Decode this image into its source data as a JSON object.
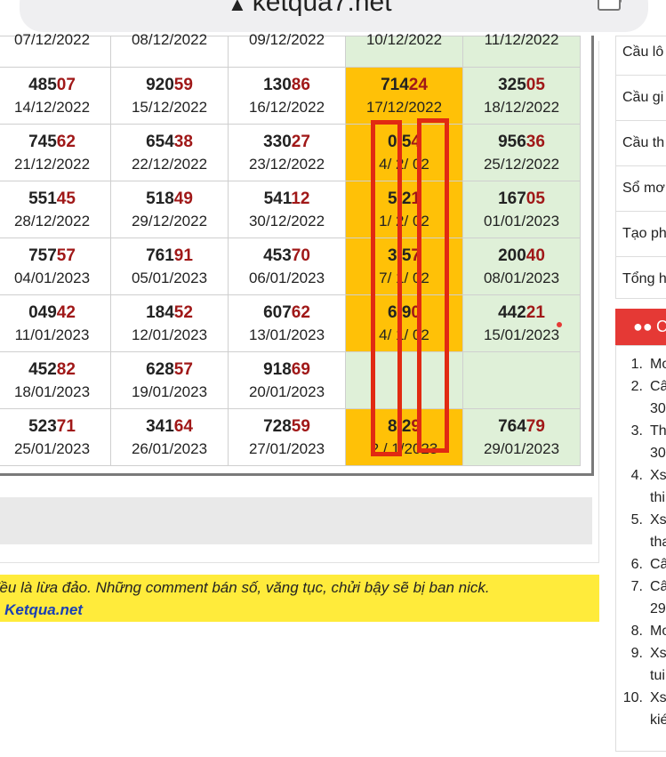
{
  "browser": {
    "url": "ketqua7.net",
    "lock_icon": "lock-icon"
  },
  "table": {
    "header_dates": [
      "07/12/2022",
      "08/12/2022",
      "09/12/2022",
      "10/12/2022",
      "11/12/2022"
    ],
    "rows": [
      [
        {
          "head": "485",
          "tail": "07",
          "date": "14/12/2022"
        },
        {
          "head": "920",
          "tail": "59",
          "date": "15/12/2022"
        },
        {
          "head": "130",
          "tail": "86",
          "date": "16/12/2022"
        },
        {
          "head": "714",
          "tail": "24",
          "date": "17/12/2022"
        },
        {
          "head": "325",
          "tail": "05",
          "date": "18/12/2022"
        }
      ],
      [
        {
          "head": "745",
          "tail": "62",
          "date": "21/12/2022"
        },
        {
          "head": "654",
          "tail": "38",
          "date": "22/12/2022"
        },
        {
          "head": "330",
          "tail": "27",
          "date": "23/12/2022"
        },
        {
          "head": "0 5",
          "tail": "4",
          "date": "4/ 2/ 02"
        },
        {
          "head": "956",
          "tail": "36",
          "date": "25/12/2022"
        }
      ],
      [
        {
          "head": "551",
          "tail": "45",
          "date": "28/12/2022"
        },
        {
          "head": "518",
          "tail": "49",
          "date": "29/12/2022"
        },
        {
          "head": "541",
          "tail": "12",
          "date": "30/12/2022"
        },
        {
          "head": "5 2",
          "tail": "1",
          "date": "1/ 2/ 02"
        },
        {
          "head": "167",
          "tail": "05",
          "date": "01/01/2023"
        }
      ],
      [
        {
          "head": "757",
          "tail": "57",
          "date": "04/01/2023"
        },
        {
          "head": "761",
          "tail": "91",
          "date": "05/01/2023"
        },
        {
          "head": "453",
          "tail": "70",
          "date": "06/01/2023"
        },
        {
          "head": "3 5",
          "tail": "7",
          "date": "7/ 1/ 02"
        },
        {
          "head": "200",
          "tail": "40",
          "date": "08/01/2023"
        }
      ],
      [
        {
          "head": "049",
          "tail": "42",
          "date": "11/01/2023"
        },
        {
          "head": "184",
          "tail": "52",
          "date": "12/01/2023"
        },
        {
          "head": "607",
          "tail": "62",
          "date": "13/01/2023"
        },
        {
          "head": "6 9",
          "tail": "0",
          "date": "4/ 1/ 02"
        },
        {
          "head": "442",
          "tail": "21",
          "date": "15/01/2023"
        }
      ],
      [
        {
          "head": "452",
          "tail": "82",
          "date": "18/01/2023"
        },
        {
          "head": "628",
          "tail": "57",
          "date": "19/01/2023"
        },
        {
          "head": "918",
          "tail": "69",
          "date": "20/01/2023"
        },
        {
          "head": "",
          "tail": "",
          "date": ""
        },
        {
          "head": "",
          "tail": "",
          "date": ""
        }
      ],
      [
        {
          "head": "523",
          "tail": "71",
          "date": "25/01/2023"
        },
        {
          "head": "341",
          "tail": "64",
          "date": "26/01/2023"
        },
        {
          "head": "728",
          "tail": "59",
          "date": "27/01/2023"
        },
        {
          "head": "8 2",
          "tail": "9",
          "date": "2 / 1/2023"
        },
        {
          "head": "764",
          "tail": "79",
          "date": "29/01/2023"
        }
      ]
    ]
  },
  "warning": {
    "line1": "đều là lừa đảo. Những comment bán số, văng tục, chửi bậy sẽ bị ban nick.",
    "line2": "n Ketqua.net"
  },
  "sidebar": {
    "links": [
      "Cầu lô",
      "Cầu gi",
      "Cầu th",
      "Sổ mơ",
      "Tạo ph",
      "Tổng h"
    ],
    "section_title": "C",
    "section_icon": "users-icon",
    "list": [
      {
        "n": "1.",
        "lines": [
          "Mo"
        ]
      },
      {
        "n": "2.",
        "lines": [
          "Câ",
          "30"
        ]
      },
      {
        "n": "3.",
        "lines": [
          "Th",
          "30"
        ]
      },
      {
        "n": "4.",
        "lines": [
          "Xs",
          "thi"
        ]
      },
      {
        "n": "5.",
        "lines": [
          "Xs",
          "tha"
        ]
      },
      {
        "n": "6.",
        "lines": [
          "Câ"
        ]
      },
      {
        "n": "7.",
        "lines": [
          "Câ",
          "29"
        ]
      },
      {
        "n": "8.",
        "lines": [
          "Mo"
        ]
      },
      {
        "n": "9.",
        "lines": [
          "Xs",
          "tui"
        ]
      },
      {
        "n": "10.",
        "lines": [
          "Xs",
          "kié"
        ]
      }
    ]
  },
  "colors": {
    "accent_red": "#e53935",
    "number_tail": "#a01818",
    "green_cell": "#dff0d8",
    "orange_cell": "#ffc107",
    "highlight_box": "#e12a12",
    "warning_bg": "#ffeb3b"
  }
}
